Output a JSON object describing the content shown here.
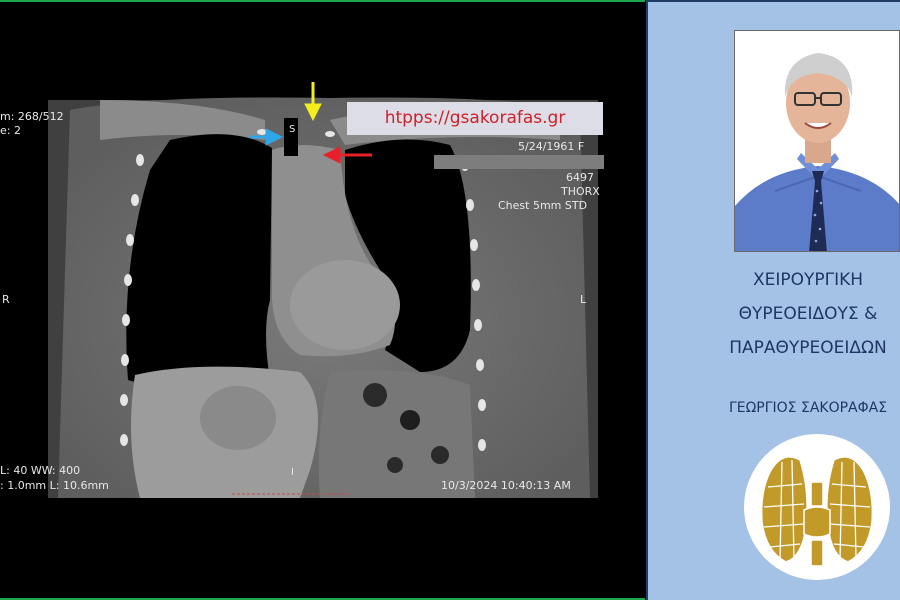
{
  "viewer": {
    "url_watermark": "htpps://gsakorafas.gr",
    "overlay": {
      "image_number": "m: 268/512",
      "series": "e: 2",
      "dob_sex": "5/24/1961 F",
      "study_id": "6497",
      "study_type": "THORX",
      "protocol": "Chest 5mm STD",
      "side_right": "R",
      "side_left": "L",
      "window": "L: 40 WW: 400",
      "slice": ": 1.0mm L: 10.6mm",
      "datetime": "10/3/2024 10:40:13 AM",
      "marker_s": "S",
      "marker_i": "I"
    },
    "arrows": [
      {
        "color": "#f5ee1d",
        "direction": "down"
      },
      {
        "color": "#2fa6e8",
        "direction": "right"
      },
      {
        "color": "#e8202a",
        "direction": "left"
      }
    ]
  },
  "panel": {
    "title_lines": [
      "ΧΕΙΡΟΥΡΓΙΚΗ",
      "ΘΥΡΕΟΕΙΔΟΥΣ &",
      "ΠΑΡΑΘΥΡΕΟΕΙΔΩΝ"
    ],
    "author": "ΓΕΩΡΓΙΟΣ ΣΑΚΟΡΑΦΑΣ",
    "logo_color": "#c29a2a"
  }
}
